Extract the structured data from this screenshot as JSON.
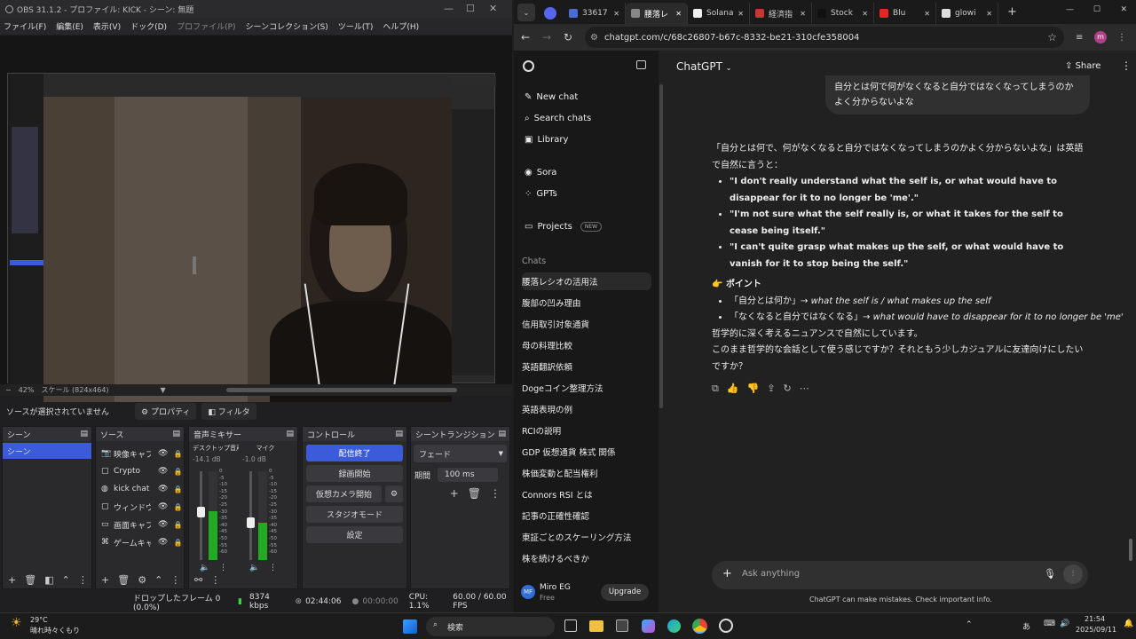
{
  "obs": {
    "title": "OBS 31.1.2 - プロファイル: KICK - シーン: 無題",
    "menu": [
      "ファイル(F)",
      "編集(E)",
      "表示(V)",
      "ドック(D)",
      "プロファイル(P)",
      "シーンコレクション(S)",
      "ツール(T)",
      "ヘルプ(H)"
    ],
    "zoom": "42%",
    "scale": "スケール (824x464)",
    "no_source": "ソースが選択されていません",
    "properties": "プロパティ",
    "filters": "フィルタ",
    "scenes_title": "シーン",
    "scene_item": "シーン",
    "sources_title": "ソース",
    "sources": [
      {
        "icon": "camera-icon",
        "label": "映像キャプチ"
      },
      {
        "icon": "window-icon",
        "label": "Crypto"
      },
      {
        "icon": "globe-icon",
        "label": "kick chat"
      },
      {
        "icon": "window-icon",
        "label": "ウィンドウキャ"
      },
      {
        "icon": "monitor-icon",
        "label": "画面キャプチ"
      },
      {
        "icon": "gamepad-icon",
        "label": "ゲームキャプ"
      }
    ],
    "mixer_title": "音声ミキサー",
    "mixer": [
      {
        "name": "デスクトップ音声",
        "db": "-14.1 dB",
        "level": 0.55
      },
      {
        "name": "マイク",
        "db": "-1.0 dB",
        "level": 0.42
      }
    ],
    "meter_ticks": [
      "0",
      "-5",
      "-10",
      "-15",
      "-20",
      "-25",
      "-30",
      "-35",
      "-40",
      "-45",
      "-50",
      "-55",
      "-60"
    ],
    "controls_title": "コントロール",
    "controls": {
      "stop_stream": "配信終了",
      "record": "録画開始",
      "vcam": "仮想カメラ開始",
      "studio": "スタジオモード",
      "settings": "設定"
    },
    "transitions_title": "シーントランジション",
    "transition": "フェード",
    "duration_label": "期間",
    "duration": "100 ms",
    "status": {
      "dropped": "ドロップしたフレーム 0 (0.0%)",
      "bitrate": "8374 kbps",
      "stream_time": "02:44:06",
      "rec_time": "00:00:00",
      "cpu": "CPU: 1.1%",
      "fps": "60.00 / 60.00 FPS"
    }
  },
  "chrome": {
    "tabs": [
      {
        "label": "33617",
        "color": "#4b6bd6"
      },
      {
        "label": "腰落レ",
        "color": "#888",
        "active": true
      },
      {
        "label": "Solana",
        "color": "#eee"
      },
      {
        "label": "経済指",
        "color": "#c33"
      },
      {
        "label": "Stock",
        "color": "#111"
      },
      {
        "label": "Blu",
        "color": "#e22"
      },
      {
        "label": "glowi",
        "color": "#ddd"
      }
    ],
    "url": "chatgpt.com/c/68c26807-b67c-8332-be21-310cfe358004"
  },
  "chatgpt": {
    "model": "ChatGPT",
    "share": "Share",
    "nav": [
      "New chat",
      "Search chats",
      "Library",
      "Sora",
      "GPTs",
      "Projects"
    ],
    "new_badge": "NEW",
    "chats_header": "Chats",
    "chats": [
      "腰落レシオの活用法",
      "腹部の凹み理由",
      "信用取引対象通貨",
      "母の料理比較",
      "英語翻訳依頼",
      "Dogeコイン整理方法",
      "英語表現の例",
      "RCIの説明",
      "GDP 仮想通貨 株式 関係",
      "株価変動と配当権利",
      "Connors RSI とは",
      "記事の正確性確認",
      "東証ごとのスケーリング方法",
      "株を続けるべきか"
    ],
    "user": {
      "initials": "MF",
      "name": "Miro EG",
      "plan": "Free",
      "upgrade": "Upgrade"
    },
    "user_msg": "自分とは何で何がなくなると自分ではなくなってしまうのかよく分からないよな",
    "reply_intro": "「自分とは何で、何がなくなると自分ではなくなってしまうのかよく分からないよな」は英語で自然に言うと：",
    "bullets": [
      "\"I don't really understand what the self is, or what would have to disappear for it to no longer be 'me'.\"",
      "\"I'm not sure what the self really is, or what it takes for the self to cease being itself.\"",
      "\"I can't quite grasp what makes up the self, or what would have to vanish for it to stop being the self.\""
    ],
    "point_title": "ポイント",
    "point1_jp": "「自分とは何か」→ ",
    "point1_en": "what the self is / what makes up the self",
    "point2_jp": "「なくなると自分ではなくなる」→ ",
    "point2_en": "what would have to disappear for it to no longer be 'me'",
    "outro1": "哲学的に深く考えるニュアンスで自然にしています。",
    "outro2": "このまま哲学的な会話として使う感じですか？それともう少しカジュアルに友達向けにしたいですか？",
    "placeholder": "Ask anything",
    "disclaimer": "ChatGPT can make mistakes. Check important info."
  },
  "taskbar": {
    "temp": "29°C",
    "weather": "晴れ時々くもり",
    "search": "検索",
    "ime": "あ",
    "time": "21:54",
    "date": "2025/09/11"
  }
}
